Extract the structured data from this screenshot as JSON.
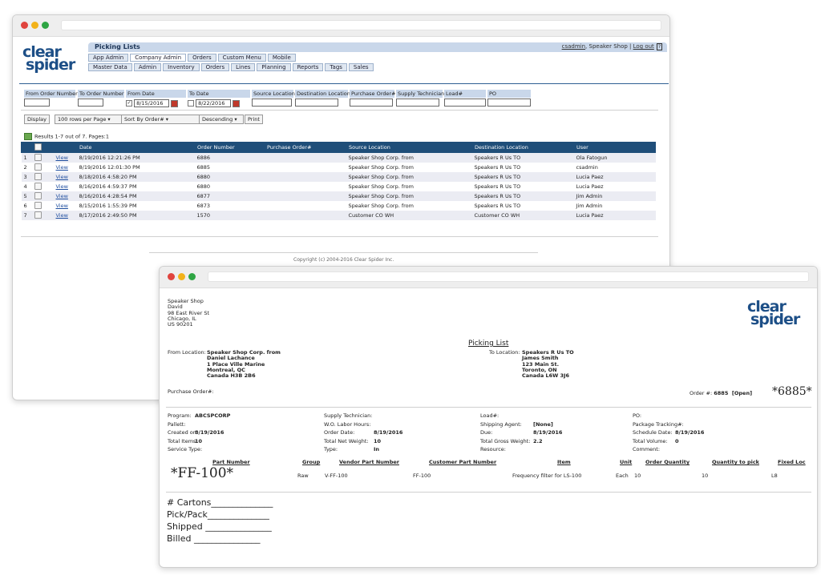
{
  "colors": {
    "navy": "#1f4e79",
    "accent": "#2f5f93",
    "tab_bg": "#dfe7f1",
    "header_bg": "#c9d7ea",
    "dot_red": "#e0443e",
    "dot_yellow": "#f2b21a",
    "dot_green": "#2ea543"
  },
  "logo": {
    "line1": "clear",
    "line2": "spider"
  },
  "app": {
    "title": "Picking Lists",
    "user": "csadmin",
    "shop": ", Speaker Shop | ",
    "logout": "Log out",
    "help": "?",
    "tabs_top": [
      "App Admin",
      "Company Admin",
      "Orders",
      "Custom Menu",
      "Mobile"
    ],
    "tabs_bottom": [
      "Master Data",
      "Admin",
      "Inventory",
      "Orders",
      "Lines",
      "Planning",
      "Reports",
      "Tags",
      "Sales"
    ]
  },
  "filters": {
    "from_order": "From Order Number",
    "to_order": "To Order Number",
    "from_date": "From Date",
    "from_date_value": "8/15/2016",
    "to_date": "To Date",
    "to_date_value": "8/22/2016",
    "source_location": "Source Location",
    "destination_location": "Destination Location",
    "purchase_order": "Purchase Order#",
    "supply_technician": "Supply Technician",
    "load": "Load#",
    "po": "PO"
  },
  "controls": {
    "display": "Display",
    "rows_per_page": "100 rows per Page",
    "sort_by": "Sort By Order#",
    "order": "Descending",
    "print": "Print"
  },
  "results": "Results 1-7 out of 7. Pages:1",
  "table": {
    "headers": [
      "Date",
      "Order Number",
      "Purchase Order#",
      "Source Location",
      "Destination Location",
      "User"
    ],
    "view_label": "View",
    "rows": [
      {
        "num": "1",
        "date": "8/19/2016 12:21:26 PM",
        "order": "6886",
        "po": "",
        "source": "Speaker Shop Corp. from",
        "dest": "Speakers R Us TO",
        "user": "Ola Fatogun"
      },
      {
        "num": "2",
        "date": "8/19/2016 12:01:30 PM",
        "order": "6885",
        "po": "",
        "source": "Speaker Shop Corp. from",
        "dest": "Speakers R Us TO",
        "user": "csadmin"
      },
      {
        "num": "3",
        "date": "8/18/2016 4:58:20 PM",
        "order": "6880",
        "po": "",
        "source": "Speaker Shop Corp. from",
        "dest": "Speakers R Us TO",
        "user": "Lucia Paez"
      },
      {
        "num": "4",
        "date": "8/16/2016 4:59:37 PM",
        "order": "6880",
        "po": "",
        "source": "Speaker Shop Corp. from",
        "dest": "Speakers R Us TO",
        "user": "Lucia Paez"
      },
      {
        "num": "5",
        "date": "8/16/2016 4:28:54 PM",
        "order": "6877",
        "po": "",
        "source": "Speaker Shop Corp. from",
        "dest": "Speakers R Us TO",
        "user": "Jim Admin"
      },
      {
        "num": "6",
        "date": "8/15/2016 1:55:39 PM",
        "order": "6873",
        "po": "",
        "source": "Speaker Shop Corp. from",
        "dest": "Speakers R Us TO",
        "user": "Jim Admin"
      },
      {
        "num": "7",
        "date": "8/17/2016 2:49:50 PM",
        "order": "1570",
        "po": "",
        "source": "Customer CO WH",
        "dest": "Customer CO WH",
        "user": "Lucia Paez"
      }
    ]
  },
  "copyright": "Copyright (c) 2004-2016 Clear Spider Inc.",
  "doc": {
    "company": "Speaker Shop\nDavid\n98 East River St\nChicago, IL\nUS 90201",
    "title": "Picking List",
    "from_label": "From Location:",
    "from_value": "Speaker Shop Corp. from\nDaniel Lachance\n1 Place Ville Marine\nMontreal, QC\nCanada H3B 2B6",
    "to_label": "To Location:",
    "to_value": "Speakers R Us TO\nJames Smith\n123 Main St.\nToronto, ON\nCanada L6W 3J6",
    "purchase_order": "Purchase Order#:",
    "order_label": "Order #:",
    "order_value": "6885  [Open]",
    "barcode": "*6885*",
    "col1_labels": "Program:\nPallett:\nCreated on:\nTotal Items:\nService Type:",
    "col1_values": "ABCSPCORP\n\n8/19/2016\n10\n",
    "col2_labels": "Supply Technician:\nW.O. Labor Hours:\nOrder Date:\nTotal Net Weight:\nType:",
    "col2_values": "\n\n8/19/2016\n10\nIn",
    "col3_labels": "Load#:\nShipping Agent:\nDue:\nTotal Gross Weight:\nResource:",
    "col3_values": "\n[None]\n8/19/2016\n2.2\n",
    "col4_labels": "PO:\nPackage Tracking#:\nSchedule Date:\nTotal Volume:\nComment:",
    "col4_values": "\n\n8/19/2016\n0\n",
    "line_headers": [
      "Part Number",
      "Group",
      "Vendor Part Number",
      "Customer Part Number",
      "Item",
      "Unit",
      "Order Quantity",
      "Quantity to pick",
      "Fixed Loc"
    ],
    "line": {
      "part": "*FF-100*",
      "group": "Raw",
      "vendor": "V-FF-100",
      "customer": "FF-100",
      "item": "Frequency filter for LS-100",
      "unit": "Each",
      "order_qty": "10",
      "pick_qty": "10",
      "loc": "L8"
    },
    "handwritten": [
      "# Cartons______________",
      "Pick/Pack______________",
      "Shipped _______________",
      "Billed _______________"
    ]
  }
}
